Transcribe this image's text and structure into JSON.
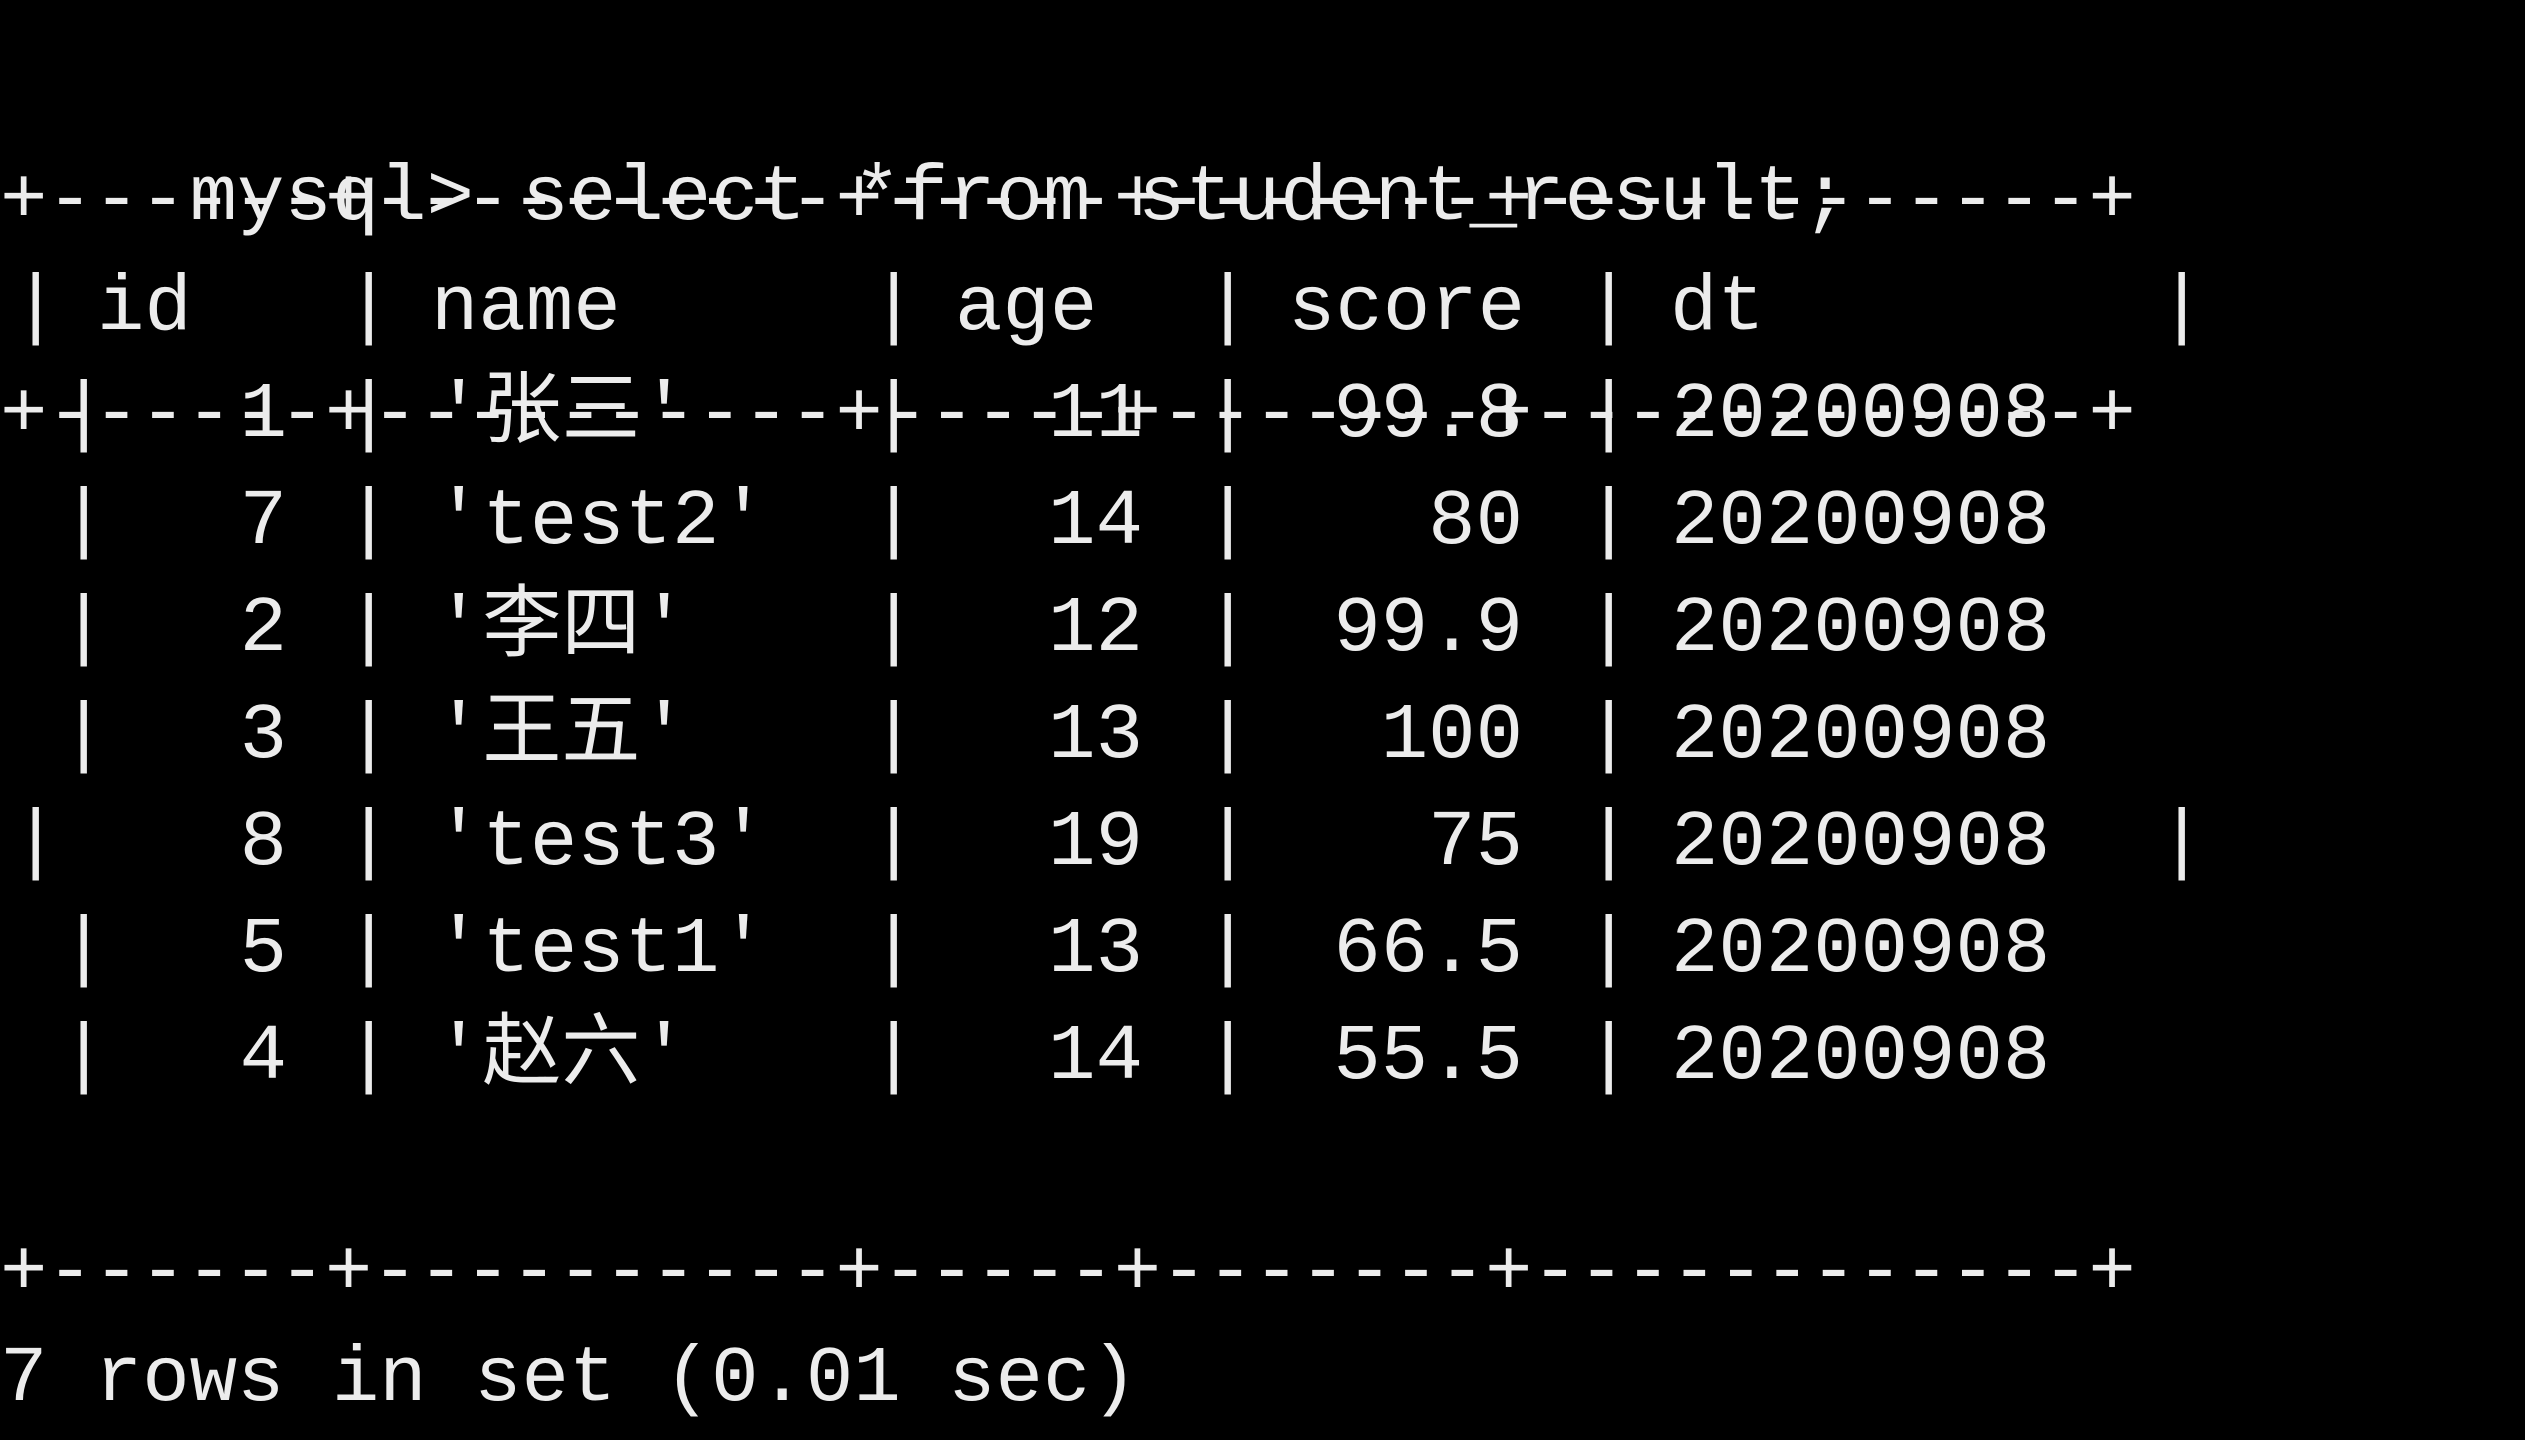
{
  "terminal": {
    "prompt": "mysql>",
    "command": "select *from student_result;",
    "footer": "7 rows in set (0.01 sec)"
  },
  "table": {
    "columns": [
      "id",
      "name",
      "age",
      "score",
      "dt"
    ],
    "rows": [
      [
        "1",
        "'张三'",
        "11",
        "99.8",
        "20200908"
      ],
      [
        "7",
        "'test2'",
        "14",
        "80",
        "20200908"
      ],
      [
        "2",
        "'李四'",
        "12",
        "99.9",
        "20200908"
      ],
      [
        "3",
        "'王五'",
        "13",
        "100",
        "20200908"
      ],
      [
        "8",
        "'test3'",
        "19",
        "75",
        "20200908"
      ],
      [
        "5",
        "'test1'",
        "13",
        "66.5",
        "20200908"
      ],
      [
        "4",
        "'赵六'",
        "14",
        "55.5",
        "20200908"
      ]
    ]
  },
  "colors": {
    "background": "#000000",
    "text": "#ececec"
  }
}
